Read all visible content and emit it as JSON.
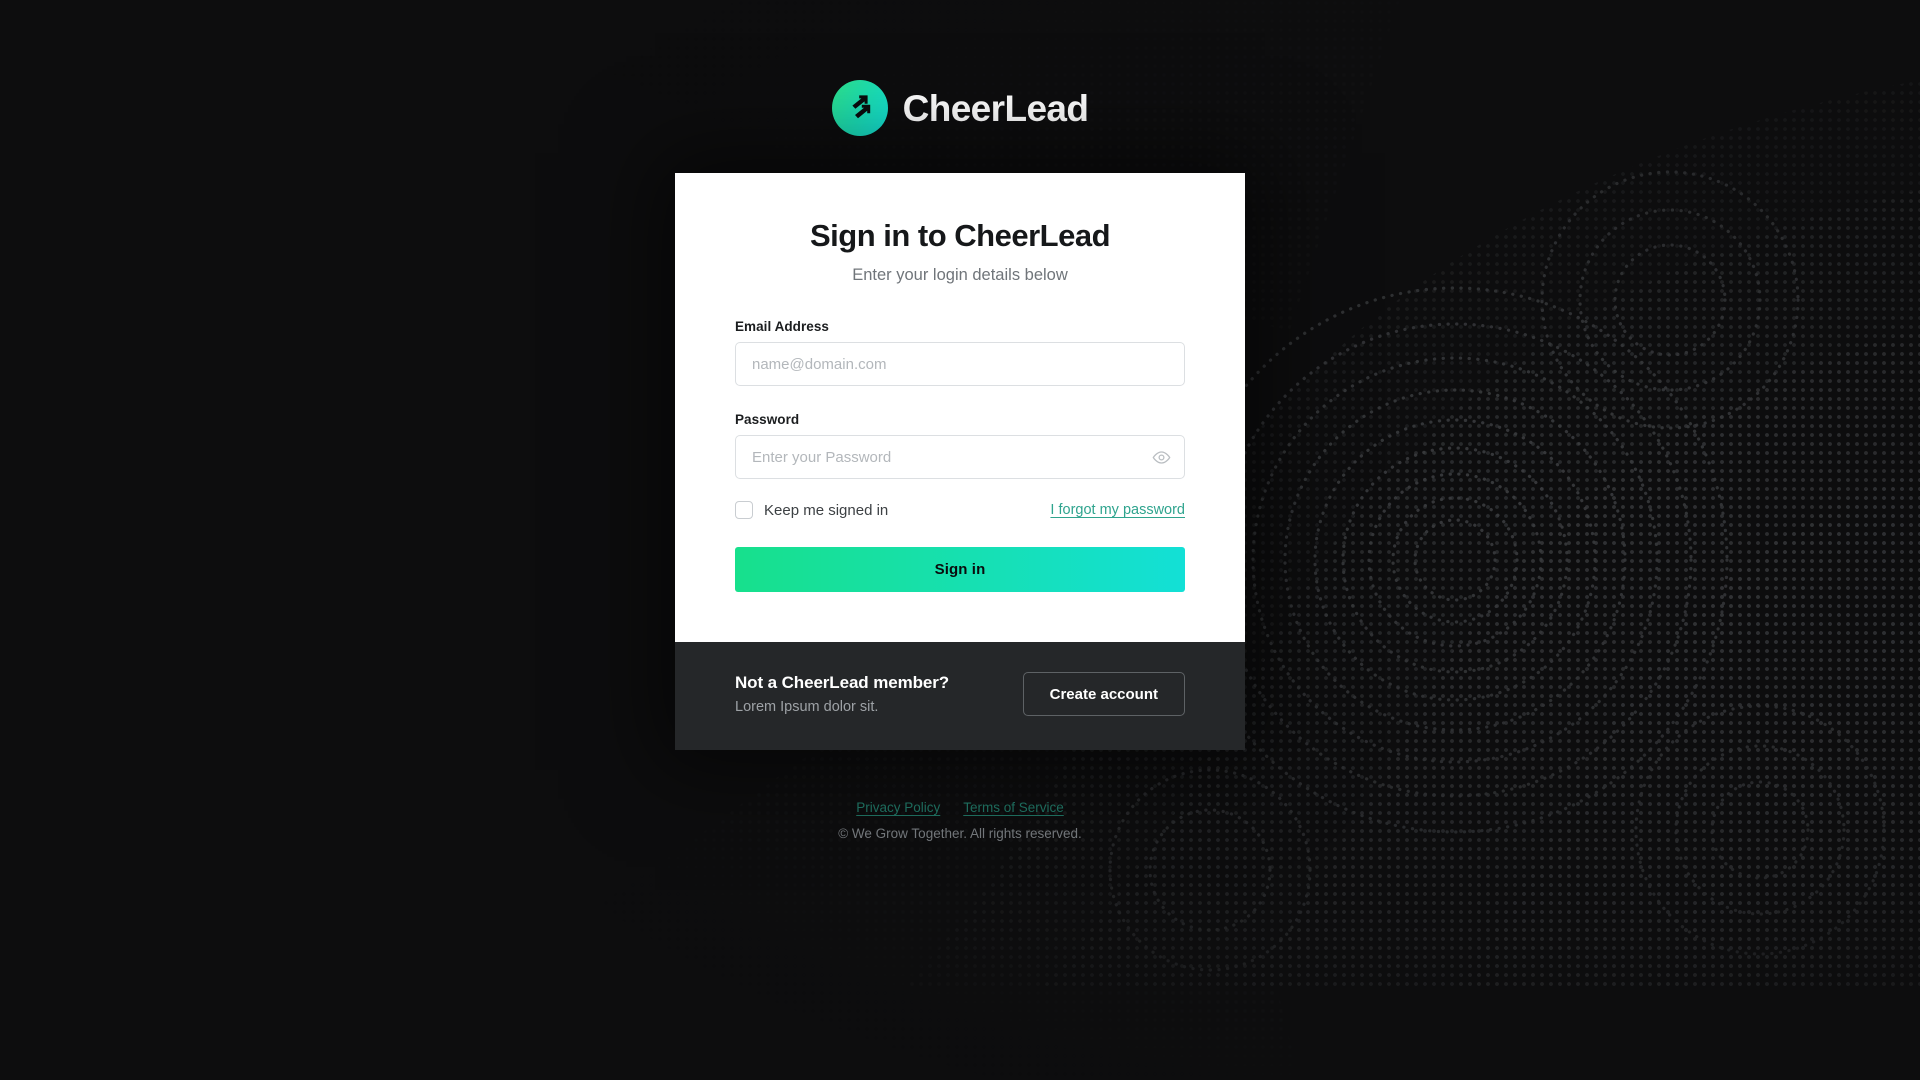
{
  "brand": {
    "name": "CheerLead",
    "logo_icon": "double-arrow-up-right-icon",
    "logo_gradient_from": "#2fe08a",
    "logo_gradient_to": "#12e0d9"
  },
  "card": {
    "title": "Sign in to CheerLead",
    "subtitle": "Enter your login details below",
    "email": {
      "label": "Email Address",
      "placeholder": "name@domain.com",
      "value": ""
    },
    "password": {
      "label": "Password",
      "placeholder": "Enter your Password",
      "value": "",
      "toggle_icon": "eye-icon"
    },
    "keep_signed_in": {
      "label": "Keep me signed in",
      "checked": false
    },
    "forgot_password_link": "I forgot my password",
    "submit_label": "Sign in",
    "submit_gradient_from": "#17e08c",
    "submit_gradient_to": "#13e0d6",
    "link_color": "#2fa48e"
  },
  "card_footer": {
    "heading": "Not a CheerLead member?",
    "subtext": "Lorem Ipsum dolor sit.",
    "create_account_label": "Create account"
  },
  "page_footer": {
    "links": [
      {
        "label": "Privacy Policy"
      },
      {
        "label": "Terms of Service"
      }
    ],
    "copyright": "© We Grow Together. All rights reserved.",
    "link_color": "#1d6b5c"
  },
  "theme": {
    "background": "#0d0d0e",
    "card_background": "#ffffff",
    "card_footer_background": "#252729"
  }
}
